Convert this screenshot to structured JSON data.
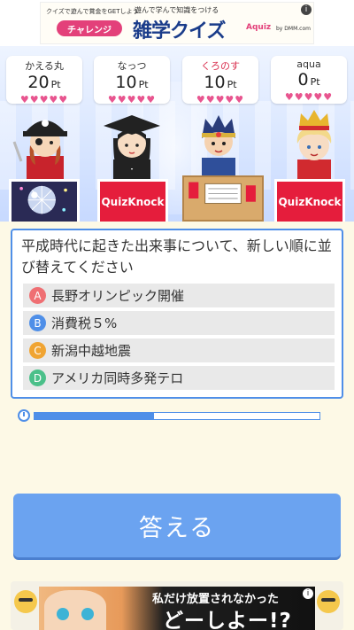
{
  "ad_top": {
    "subtitle": "クイズで遊んで賞金をGETしよう!",
    "button_label": "チャレンジ",
    "tagline": "遊んで学んで知識をつける",
    "title": "雑学クイズ",
    "brand": "Aquiz",
    "brand_by": "by DMM.com",
    "info": "i"
  },
  "players": [
    {
      "name": "かえる丸",
      "score": "20",
      "unit": "Pt",
      "hearts": "♥♥♥♥♥",
      "current": false,
      "podium": "disco"
    },
    {
      "name": "なっつ",
      "score": "10",
      "unit": "Pt",
      "hearts": "♥♥♥♥♥",
      "current": false,
      "podium": "QuizKnock"
    },
    {
      "name": "くろのす",
      "score": "10",
      "unit": "Pt",
      "hearts": "♥♥♥♥♥",
      "current": true,
      "podium": "box"
    },
    {
      "name": "aqua",
      "score": "0",
      "unit": "Pt",
      "hearts": "♥♥♥♥♥",
      "current": false,
      "podium": "QuizKnock"
    }
  ],
  "podium_labels": {
    "quizknock": "QuizKnock"
  },
  "question": {
    "text": "平成時代に起きた出来事について、新しい順に並び替えてください",
    "answers": [
      {
        "letter": "A",
        "label": "長野オリンピック開催",
        "color": "#ef6f73"
      },
      {
        "letter": "B",
        "label": "消費税５%",
        "color": "#4f8fe8"
      },
      {
        "letter": "C",
        "label": "新潟中越地震",
        "color": "#f0a432"
      },
      {
        "letter": "D",
        "label": "アメリカ同時多発テロ",
        "color": "#4bc08a"
      }
    ]
  },
  "timer": {
    "remaining_fraction": 0.42
  },
  "answer_button": {
    "label": "答える"
  },
  "ad_bottom": {
    "line1": "私だけ放置されなかった",
    "line2": "どーしよー!?",
    "info": "i"
  }
}
